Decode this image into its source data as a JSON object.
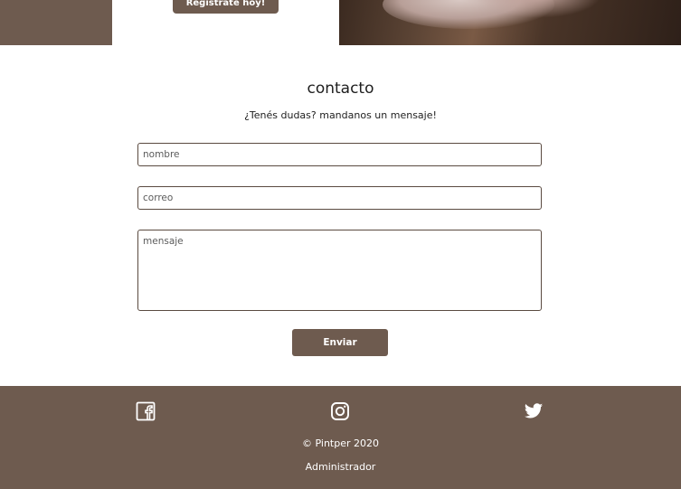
{
  "hero": {
    "register_label": "Registrate hoy!"
  },
  "contact": {
    "title": "contacto",
    "subtitle": "¿Tenés dudas? mandanos un mensaje!",
    "name_placeholder": "nombre",
    "email_placeholder": "correo",
    "message_placeholder": "mensaje",
    "send_label": "Enviar"
  },
  "footer": {
    "social": [
      "facebook-icon",
      "instagram-icon",
      "twitter-icon"
    ],
    "copyright": "© Pintper 2020",
    "admin_link": "Administrador"
  },
  "colors": {
    "brand": "#6e5b4f",
    "text": "#1e1e1e",
    "background": "#ffffff"
  }
}
